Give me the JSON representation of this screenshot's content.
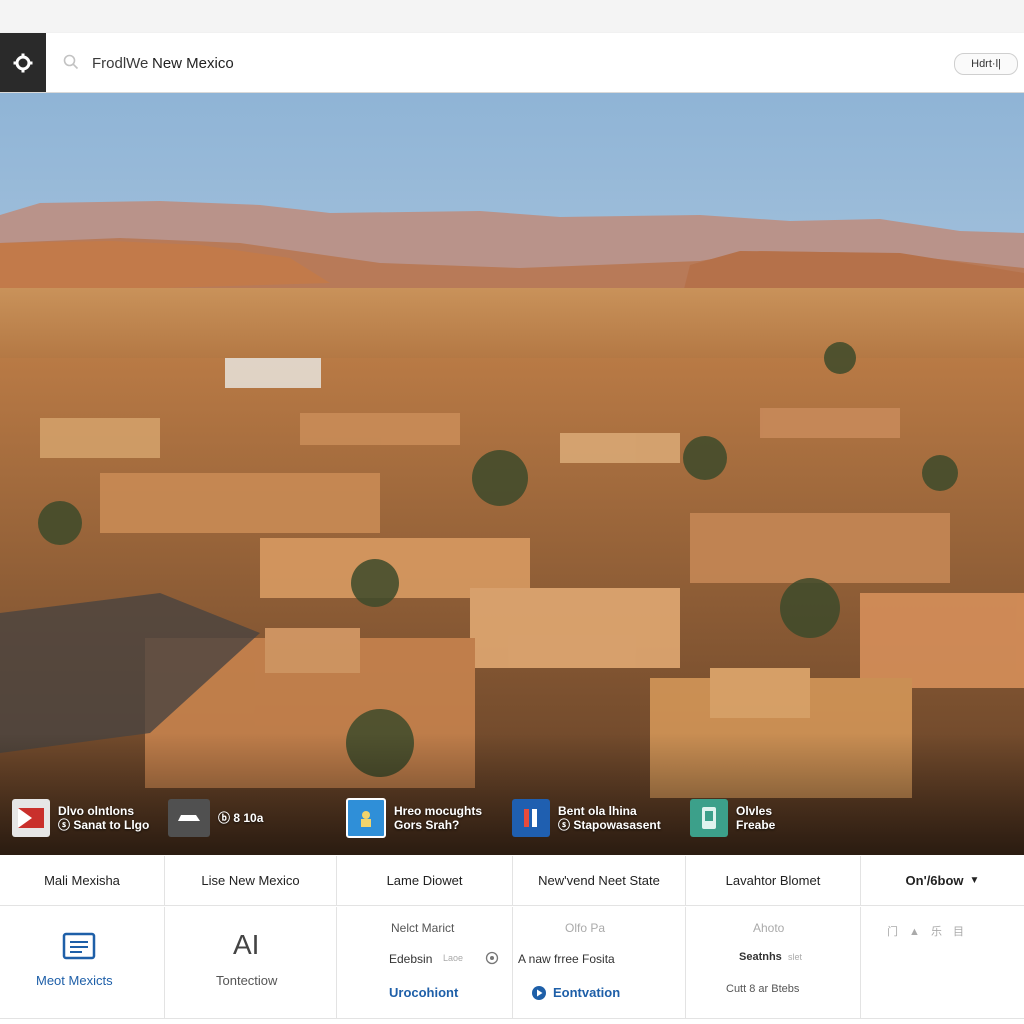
{
  "topbar": {
    "search_prefix": "FrodlWe",
    "search_query": "New Mexico",
    "right_button": "Hdrt·l|"
  },
  "promos": [
    {
      "line1": "Dlvo olntlons",
      "line2": "Sanat to Llgo",
      "color": "#c9302c"
    },
    {
      "line1": "",
      "line2": "8 10a",
      "color": "#5a5a5a"
    },
    {
      "line1": "Hreo mocughts",
      "line2": "Gors Srah?",
      "color": "#2f8fd8"
    },
    {
      "line1": "Bent ola lhina",
      "line2": "Stapowasasent",
      "color": "#1f5fb0"
    },
    {
      "line1": "Olvles",
      "line2": "Freabe",
      "color": "#3ca08a"
    }
  ],
  "columns": [
    {
      "header": "Mali Mexisha"
    },
    {
      "header": "Lise New Mexico"
    },
    {
      "header": "Lame Diowet"
    },
    {
      "header": "New'vend Neet State"
    },
    {
      "header": "Lavahtor Blomet"
    },
    {
      "header": "On'/6bow"
    }
  ],
  "col1": {
    "link": "Meot Mexicts"
  },
  "col2": {
    "icon_text": "AI",
    "label": "Tontectiow"
  },
  "col3": {
    "line1": "Nelct Marict",
    "line2": "Edebsin",
    "line2b": "Laoe",
    "line3": "Urocohiont"
  },
  "col4": {
    "line1": "Olfo Pa",
    "line2": "A naw frree Fosita",
    "line3": "Eontvation"
  },
  "col5": {
    "line1": "Ahoto",
    "line2": "Seatnhs",
    "line2b": "slet",
    "line3": "Cutt 8 ar Btebs"
  },
  "col6": {
    "line1": "门 ▲ 乐 目"
  },
  "colors": {
    "accent_blue": "#1e5fa8",
    "topbar_dark": "#2a2a2a"
  }
}
